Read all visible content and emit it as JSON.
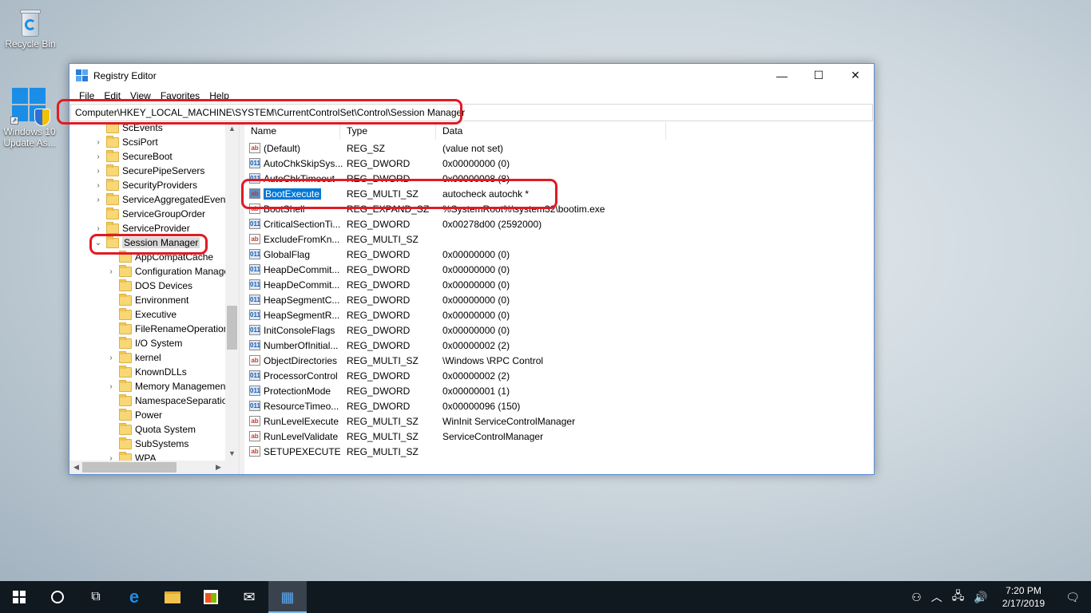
{
  "desktop": {
    "icons": [
      {
        "label": "Recycle Bin"
      },
      {
        "label_line1": "Windows 10",
        "label_line2": "Update As..."
      }
    ]
  },
  "window": {
    "title": "Registry Editor",
    "controls": {
      "minimize": "—",
      "maximize": "☐",
      "close": "✕"
    },
    "menu": [
      "File",
      "Edit",
      "View",
      "Favorites",
      "Help"
    ],
    "address": "Computer\\HKEY_LOCAL_MACHINE\\SYSTEM\\CurrentControlSet\\Control\\Session Manager"
  },
  "tree": {
    "items": [
      {
        "label": "ScEvents",
        "expandable": false
      },
      {
        "label": "ScsiPort",
        "expandable": true
      },
      {
        "label": "SecureBoot",
        "expandable": true
      },
      {
        "label": "SecurePipeServers",
        "expandable": true
      },
      {
        "label": "SecurityProviders",
        "expandable": true
      },
      {
        "label": "ServiceAggregatedEvents",
        "expandable": true
      },
      {
        "label": "ServiceGroupOrder",
        "expandable": false
      },
      {
        "label": "ServiceProvider",
        "expandable": true
      },
      {
        "label": "Session Manager",
        "expandable": true,
        "expanded": true,
        "selected": true
      },
      {
        "label": "AppCompatCache",
        "child": true
      },
      {
        "label": "Configuration Manager",
        "child": true,
        "expandable": true
      },
      {
        "label": "DOS Devices",
        "child": true
      },
      {
        "label": "Environment",
        "child": true
      },
      {
        "label": "Executive",
        "child": true
      },
      {
        "label": "FileRenameOperations",
        "child": true
      },
      {
        "label": "I/O System",
        "child": true
      },
      {
        "label": "kernel",
        "child": true,
        "expandable": true
      },
      {
        "label": "KnownDLLs",
        "child": true
      },
      {
        "label": "Memory Management",
        "child": true,
        "expandable": true
      },
      {
        "label": "NamespaceSeparation",
        "child": true
      },
      {
        "label": "Power",
        "child": true
      },
      {
        "label": "Quota System",
        "child": true
      },
      {
        "label": "SubSystems",
        "child": true
      },
      {
        "label": "WPA",
        "child": true,
        "expandable": true
      }
    ]
  },
  "list": {
    "columns": [
      "Name",
      "Type",
      "Data"
    ],
    "rows": [
      {
        "name": "(Default)",
        "type": "REG_SZ",
        "data": "(value not set)",
        "icon": "ab"
      },
      {
        "name": "AutoChkSkipSys...",
        "type": "REG_DWORD",
        "data": "0x00000000 (0)",
        "icon": "bin"
      },
      {
        "name": "AutoChkTimeout",
        "type": "REG_DWORD",
        "data": "0x00000008 (8)",
        "icon": "bin"
      },
      {
        "name": "BootExecute",
        "type": "REG_MULTI_SZ",
        "data": "autocheck autochk *",
        "icon": "ab",
        "selected": true
      },
      {
        "name": "BootShell",
        "type": "REG_EXPAND_SZ",
        "data": "%SystemRoot%\\system32\\bootim.exe",
        "icon": "ab"
      },
      {
        "name": "CriticalSectionTi...",
        "type": "REG_DWORD",
        "data": "0x00278d00 (2592000)",
        "icon": "bin"
      },
      {
        "name": "ExcludeFromKn...",
        "type": "REG_MULTI_SZ",
        "data": "",
        "icon": "ab"
      },
      {
        "name": "GlobalFlag",
        "type": "REG_DWORD",
        "data": "0x00000000 (0)",
        "icon": "bin"
      },
      {
        "name": "HeapDeCommit...",
        "type": "REG_DWORD",
        "data": "0x00000000 (0)",
        "icon": "bin"
      },
      {
        "name": "HeapDeCommit...",
        "type": "REG_DWORD",
        "data": "0x00000000 (0)",
        "icon": "bin"
      },
      {
        "name": "HeapSegmentC...",
        "type": "REG_DWORD",
        "data": "0x00000000 (0)",
        "icon": "bin"
      },
      {
        "name": "HeapSegmentR...",
        "type": "REG_DWORD",
        "data": "0x00000000 (0)",
        "icon": "bin"
      },
      {
        "name": "InitConsoleFlags",
        "type": "REG_DWORD",
        "data": "0x00000000 (0)",
        "icon": "bin"
      },
      {
        "name": "NumberOfInitial...",
        "type": "REG_DWORD",
        "data": "0x00000002 (2)",
        "icon": "bin"
      },
      {
        "name": "ObjectDirectories",
        "type": "REG_MULTI_SZ",
        "data": "\\Windows \\RPC Control",
        "icon": "ab"
      },
      {
        "name": "ProcessorControl",
        "type": "REG_DWORD",
        "data": "0x00000002 (2)",
        "icon": "bin"
      },
      {
        "name": "ProtectionMode",
        "type": "REG_DWORD",
        "data": "0x00000001 (1)",
        "icon": "bin"
      },
      {
        "name": "ResourceTimeo...",
        "type": "REG_DWORD",
        "data": "0x00000096 (150)",
        "icon": "bin"
      },
      {
        "name": "RunLevelExecute",
        "type": "REG_MULTI_SZ",
        "data": "WinInit ServiceControlManager",
        "icon": "ab"
      },
      {
        "name": "RunLevelValidate",
        "type": "REG_MULTI_SZ",
        "data": "ServiceControlManager",
        "icon": "ab"
      },
      {
        "name": "SETUPEXECUTE",
        "type": "REG_MULTI_SZ",
        "data": "",
        "icon": "ab"
      }
    ]
  },
  "taskbar": {
    "apps": [
      "start-icon",
      "search-icon",
      "task-view-icon",
      "edge-icon",
      "file-explorer-icon",
      "store-icon",
      "mail-icon",
      "registry-editor-icon"
    ],
    "time": "7:20 PM",
    "date": "2/17/2019"
  },
  "colors": {
    "selection": "#0078d7",
    "annotation": "#e01b24",
    "taskbar": "#101820"
  }
}
